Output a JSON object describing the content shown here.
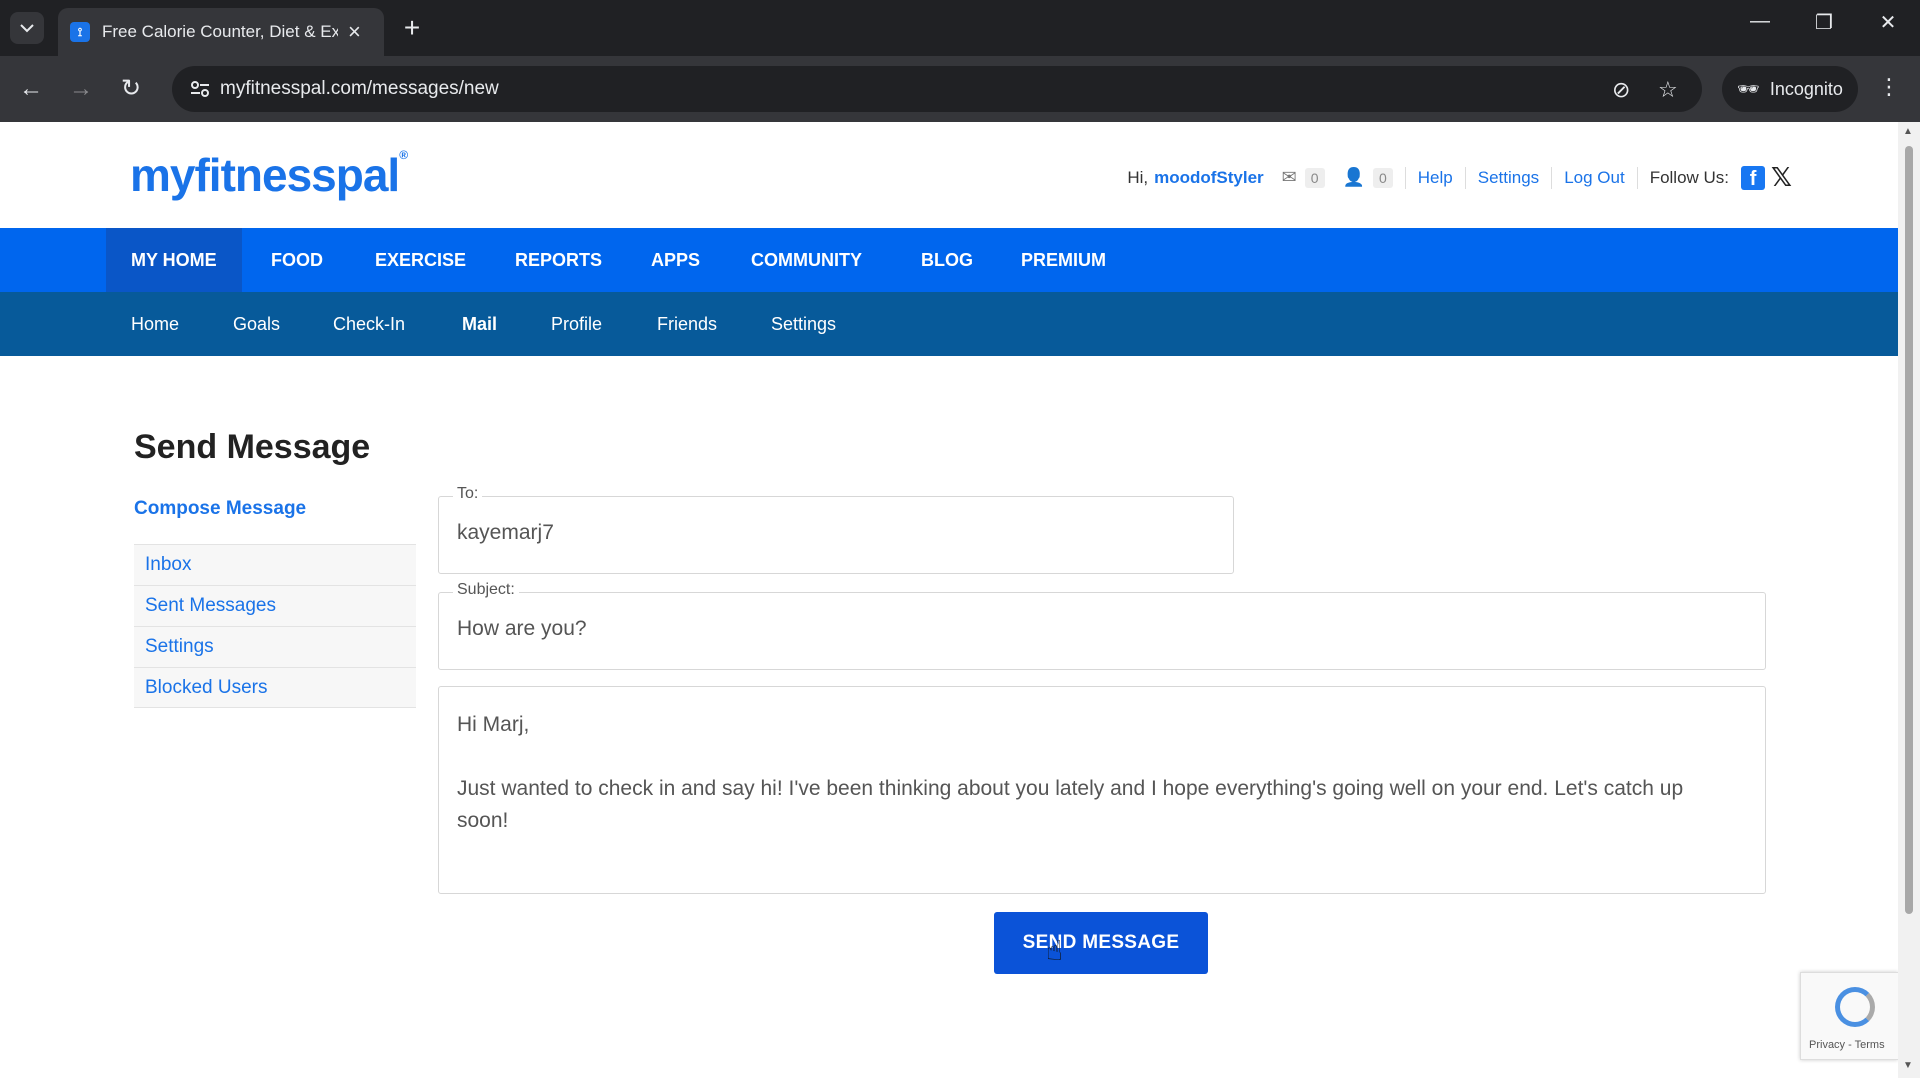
{
  "browser": {
    "tab_title": "Free Calorie Counter, Diet & Ex",
    "url": "myfitnesspal.com/messages/new",
    "incognito_label": "Incognito"
  },
  "site": {
    "logo": "myfitnesspal",
    "greeting": "Hi,",
    "username": "moodofStyler",
    "mail_count": "0",
    "friend_count": "0",
    "links": {
      "help": "Help",
      "settings": "Settings",
      "logout": "Log Out"
    },
    "follow_label": "Follow Us:"
  },
  "main_nav": [
    "MY HOME",
    "FOOD",
    "EXERCISE",
    "REPORTS",
    "APPS",
    "COMMUNITY",
    "BLOG",
    "PREMIUM"
  ],
  "sub_nav": [
    "Home",
    "Goals",
    "Check-In",
    "Mail",
    "Profile",
    "Friends",
    "Settings"
  ],
  "page": {
    "title": "Send Message",
    "compose_label": "Compose Message",
    "sidebar": [
      "Inbox",
      "Sent Messages",
      "Settings",
      "Blocked Users"
    ]
  },
  "form": {
    "to_label": "To:",
    "to_value": "kayemarj7",
    "subject_label": "Subject:",
    "subject_value": "How are you?",
    "body": "Hi Marj,\n\nJust wanted to check in and say hi! I've been thinking about you lately and I hope everything's going well on your end. Let's catch up soon!",
    "send_label": "SEND MESSAGE"
  },
  "recaptcha": {
    "text": "Privacy - Terms"
  },
  "colors": {
    "primary_blue": "#0066ee",
    "subnav_blue": "#075a9a",
    "link_blue": "#1a73e8",
    "button_blue": "#0b53d8"
  }
}
